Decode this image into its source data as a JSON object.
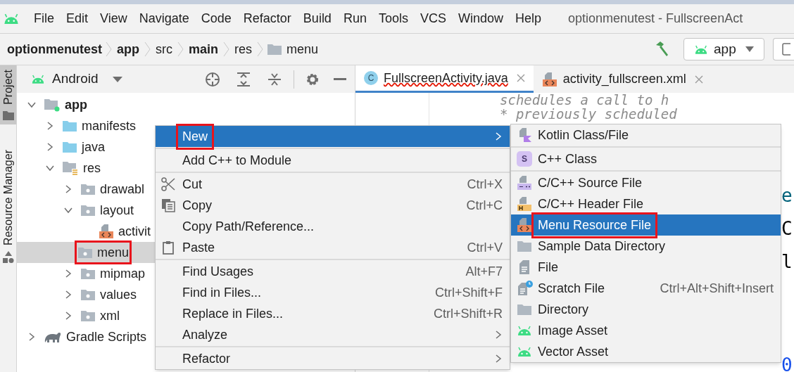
{
  "menubar": {
    "items": [
      "File",
      "Edit",
      "View",
      "Navigate",
      "Code",
      "Refactor",
      "Build",
      "Run",
      "Tools",
      "VCS",
      "Window",
      "Help"
    ],
    "title": "optionmenutest - FullscreenAct"
  },
  "breadcrumbs": [
    {
      "label": "optionmenutest",
      "bold": true,
      "kind": "text"
    },
    {
      "label": "app",
      "bold": true,
      "kind": "text"
    },
    {
      "label": "src",
      "bold": false,
      "kind": "text"
    },
    {
      "label": "main",
      "bold": true,
      "kind": "text"
    },
    {
      "label": "res",
      "bold": false,
      "kind": "text"
    },
    {
      "label": "menu",
      "bold": false,
      "kind": "folder"
    }
  ],
  "run_config": {
    "label": "app"
  },
  "side_tabs": [
    {
      "label": "Project",
      "selected": true
    },
    {
      "label": "Resource Manager",
      "selected": false
    }
  ],
  "project_panel": {
    "view": "Android"
  },
  "tree": [
    {
      "label": "app",
      "kind": "module",
      "expanded": true,
      "selected": false,
      "highlighted": false,
      "children": [
        {
          "label": "manifests",
          "kind": "folder",
          "expanded": false,
          "selected": false,
          "highlighted": false
        },
        {
          "label": "java",
          "kind": "folder",
          "expanded": false,
          "selected": false,
          "highlighted": false
        },
        {
          "label": "res",
          "kind": "res",
          "expanded": true,
          "selected": false,
          "highlighted": false,
          "children": [
            {
              "label": "drawabl",
              "kind": "resdir",
              "expanded": false,
              "selected": false,
              "highlighted": false
            },
            {
              "label": "layout",
              "kind": "resdir",
              "expanded": true,
              "selected": false,
              "highlighted": false,
              "children": [
                {
                  "label": "activit",
                  "kind": "xml",
                  "selected": false,
                  "highlighted": false
                }
              ]
            },
            {
              "label": "menu",
              "kind": "resdir",
              "selected": true,
              "highlighted": true
            },
            {
              "label": "mipmap",
              "kind": "resdir",
              "expanded": false,
              "selected": false,
              "highlighted": false
            },
            {
              "label": "values",
              "kind": "resdir",
              "expanded": false,
              "selected": false,
              "highlighted": false
            },
            {
              "label": "xml",
              "kind": "resdir",
              "expanded": false,
              "selected": false,
              "highlighted": false
            }
          ]
        }
      ]
    },
    {
      "label": "Gradle Scripts",
      "kind": "gradle",
      "expanded": false,
      "selected": false,
      "highlighted": false
    }
  ],
  "editor_tabs": [
    {
      "label": "FullscreenActivity.java",
      "kind": "java",
      "icon_letter": "C",
      "selected": true
    },
    {
      "label": "activity_fullscreen.xml",
      "kind": "xml",
      "selected": false
    }
  ],
  "code_lines": [
    "schedules a call to h",
    "* previously scheduled"
  ],
  "code_fragments": [
    {
      "text": "e",
      "color": "#00627a"
    },
    {
      "text": "C",
      "color": "#080808"
    },
    {
      "text": "l",
      "color": "#080808"
    },
    {
      "text": "0",
      "color": "#1750eb"
    }
  ],
  "context_menu": [
    {
      "kind": "plain",
      "label": "New",
      "submenu": true,
      "selected": true,
      "highlighted": true
    },
    {
      "kind": "separator"
    },
    {
      "kind": "plain",
      "label": "Add C++ to Module",
      "submenu": false,
      "selected": false,
      "highlighted": false
    },
    {
      "kind": "separator"
    },
    {
      "kind": "cut",
      "label": "Cut",
      "shortcut": "Ctrl+X",
      "submenu": false,
      "selected": false,
      "highlighted": false
    },
    {
      "kind": "copy",
      "label": "Copy",
      "shortcut": "Ctrl+C",
      "submenu": false,
      "selected": false,
      "highlighted": false
    },
    {
      "kind": "plain",
      "label": "Copy Path/Reference...",
      "submenu": false,
      "selected": false,
      "highlighted": false
    },
    {
      "kind": "paste",
      "label": "Paste",
      "shortcut": "Ctrl+V",
      "submenu": false,
      "selected": false,
      "highlighted": false
    },
    {
      "kind": "separator"
    },
    {
      "kind": "plain",
      "label": "Find Usages",
      "shortcut": "Alt+F7",
      "submenu": false,
      "selected": false,
      "highlighted": false
    },
    {
      "kind": "plain",
      "label": "Find in Files...",
      "shortcut": "Ctrl+Shift+F",
      "submenu": false,
      "selected": false,
      "highlighted": false
    },
    {
      "kind": "plain",
      "label": "Replace in Files...",
      "shortcut": "Ctrl+Shift+R",
      "submenu": false,
      "selected": false,
      "highlighted": false
    },
    {
      "kind": "plain",
      "label": "Analyze",
      "submenu": true,
      "selected": false,
      "highlighted": false
    },
    {
      "kind": "separator"
    },
    {
      "kind": "plain",
      "label": "Refactor",
      "submenu": true,
      "selected": false,
      "highlighted": false
    }
  ],
  "submenu": [
    {
      "kind": "kotlin",
      "label": "Kotlin Class/File",
      "selected": false,
      "highlighted": false
    },
    {
      "kind": "separator"
    },
    {
      "kind": "cppclass",
      "label": "C++ Class",
      "icon_letter": "S",
      "selected": false,
      "highlighted": false
    },
    {
      "kind": "separator"
    },
    {
      "kind": "cppsource",
      "label": "C/C++ Source File",
      "selected": false,
      "highlighted": false
    },
    {
      "kind": "cppheader",
      "label": "C/C++ Header File",
      "selected": false,
      "highlighted": false
    },
    {
      "kind": "xml",
      "label": "Menu Resource File",
      "selected": true,
      "highlighted": true
    },
    {
      "kind": "folder",
      "label": "Sample Data Directory",
      "selected": false,
      "highlighted": false
    },
    {
      "kind": "file",
      "label": "File",
      "selected": false,
      "highlighted": false
    },
    {
      "kind": "scratch",
      "label": "Scratch File",
      "shortcut": "Ctrl+Alt+Shift+Insert",
      "selected": false,
      "highlighted": false
    },
    {
      "kind": "folder",
      "label": "Directory",
      "selected": false,
      "highlighted": false
    },
    {
      "kind": "android",
      "label": "Image Asset",
      "selected": false,
      "highlighted": false
    },
    {
      "kind": "android",
      "label": "Vector Asset",
      "selected": false,
      "highlighted": false
    }
  ]
}
